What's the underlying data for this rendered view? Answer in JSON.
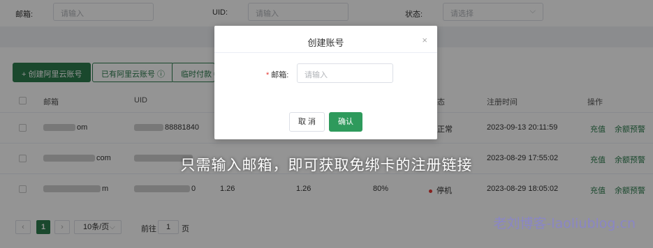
{
  "filters": {
    "email_label": "邮箱:",
    "email_placeholder": "请输入",
    "uid_label": "UID:",
    "uid_placeholder": "请输入",
    "status_label": "状态:",
    "status_placeholder": "请选择"
  },
  "toolbar": {
    "create_aliyun": "+ 创建阿里云账号",
    "existing_aliyun": "已有阿里云账号 ⓘ",
    "temp_pay": "临时付款 ⓘ"
  },
  "table": {
    "headers": {
      "email": "邮箱",
      "uid": "UID",
      "status": "态",
      "register_time": "注册时间",
      "actions": "操作"
    },
    "rows": [
      {
        "email_tail": "om",
        "uid_tail": "88881840",
        "col3": "",
        "col4": "",
        "col5": "",
        "status": "正常",
        "register_time": "2023-09-13 20:11:59",
        "action1": "充值",
        "action2": "余额预警"
      },
      {
        "email_tail": "com",
        "uid_tail": "",
        "col3": "",
        "col4": "",
        "col5": "",
        "status": "",
        "register_time": "2023-08-29 17:55:02",
        "action1": "充值",
        "action2": "余额预警"
      },
      {
        "email_tail": "m",
        "uid_tail": "0",
        "col3": "1.26",
        "col4": "1.26",
        "col5": "80%",
        "status": "停机",
        "register_time": "2023-08-29 18:05:02",
        "action1": "充值",
        "action2": "余额预警"
      }
    ]
  },
  "pagination": {
    "prev": "‹",
    "current": "1",
    "next": "›",
    "page_size": "10条/页",
    "goto_label": "前往",
    "goto_value": "1",
    "page_unit": "页"
  },
  "modal": {
    "title": "创建账号",
    "close": "×",
    "required_mark": "*",
    "email_label": "邮箱:",
    "email_placeholder": "请输入",
    "cancel": "取 消",
    "confirm": "确认"
  },
  "caption": "只需输入邮箱，即可获取免绑卡的注册链接",
  "watermark": "老刘博客-laoliublog.cn",
  "colors": {
    "primary": "#2e7d4f",
    "confirm": "#2e9a5c",
    "danger": "#e53935"
  }
}
